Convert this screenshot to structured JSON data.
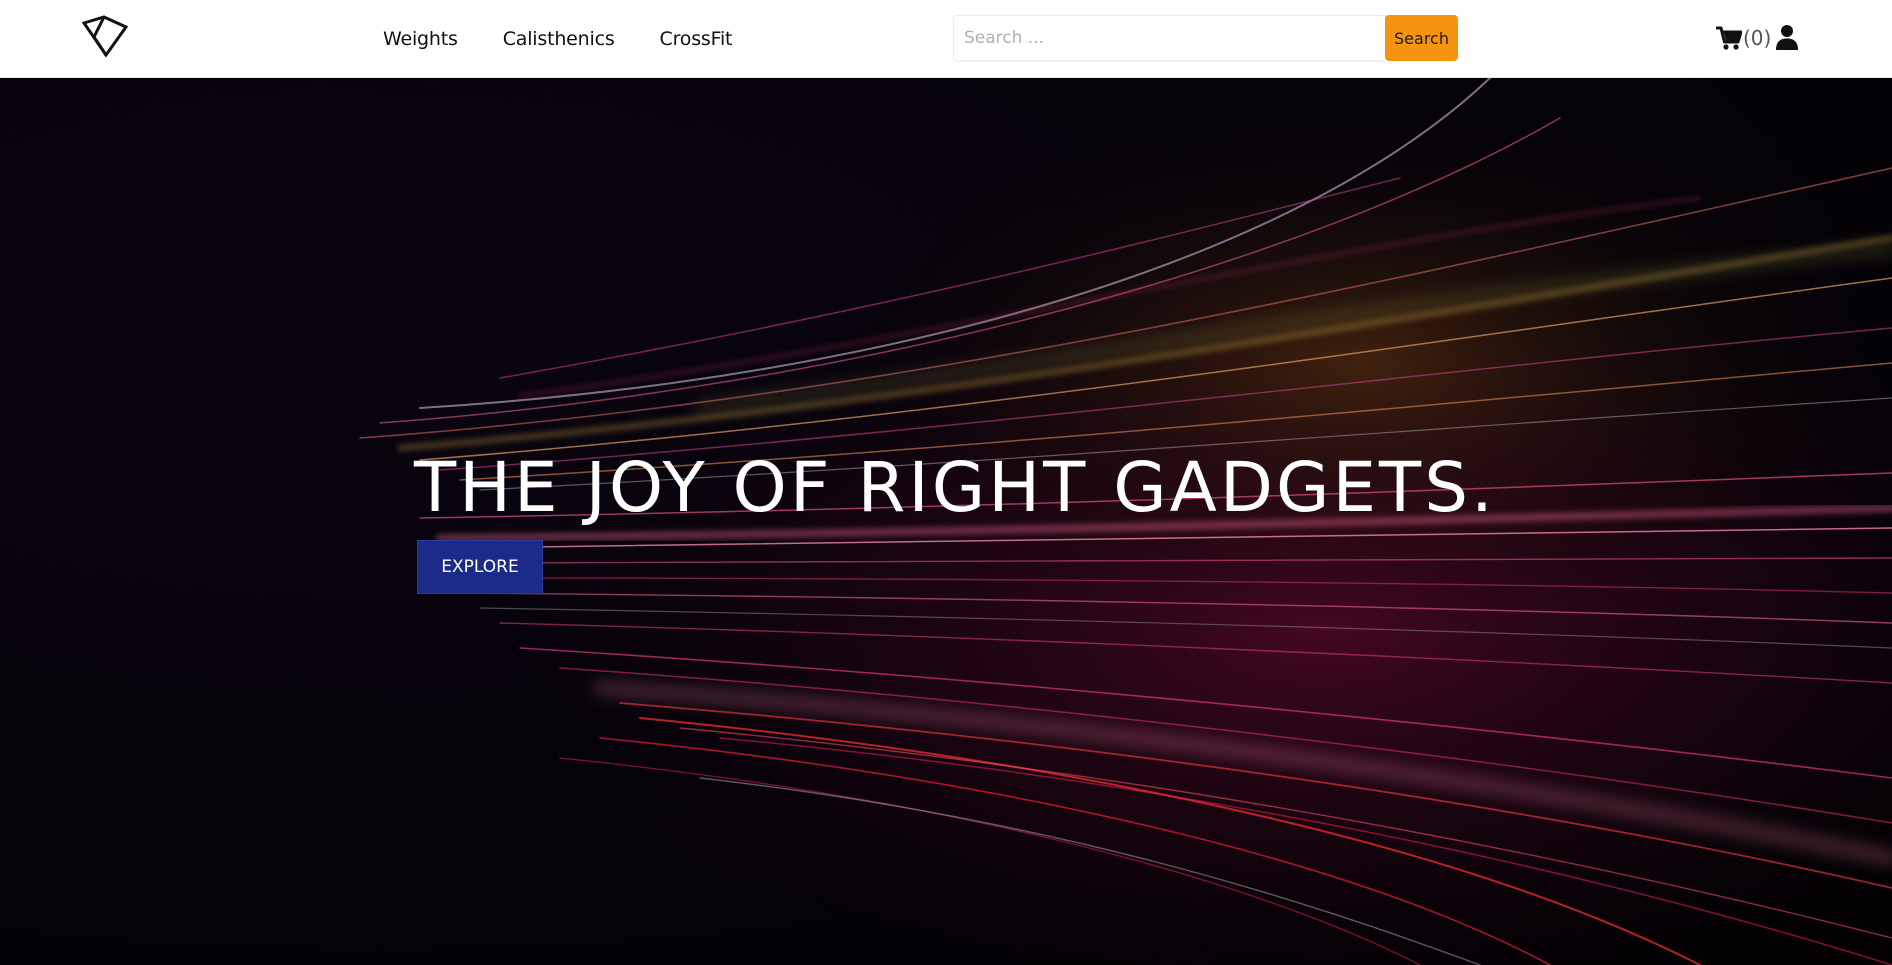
{
  "nav": {
    "logo_icon": "diamond-heart-logo-icon",
    "links": [
      {
        "label": "Weights"
      },
      {
        "label": "Calisthenics"
      },
      {
        "label": "CrossFit"
      }
    ]
  },
  "search": {
    "placeholder": "Search ...",
    "value": "",
    "button_label": "Search",
    "button_color": "#f7940f"
  },
  "cart": {
    "icon": "cart-icon",
    "count_text": "(0)"
  },
  "user": {
    "icon": "user-icon"
  },
  "hero": {
    "title": "THE JOY OF RIGHT GADGETS.",
    "cta_label": "EXPLORE",
    "cta_color": "#1c2a8a"
  }
}
